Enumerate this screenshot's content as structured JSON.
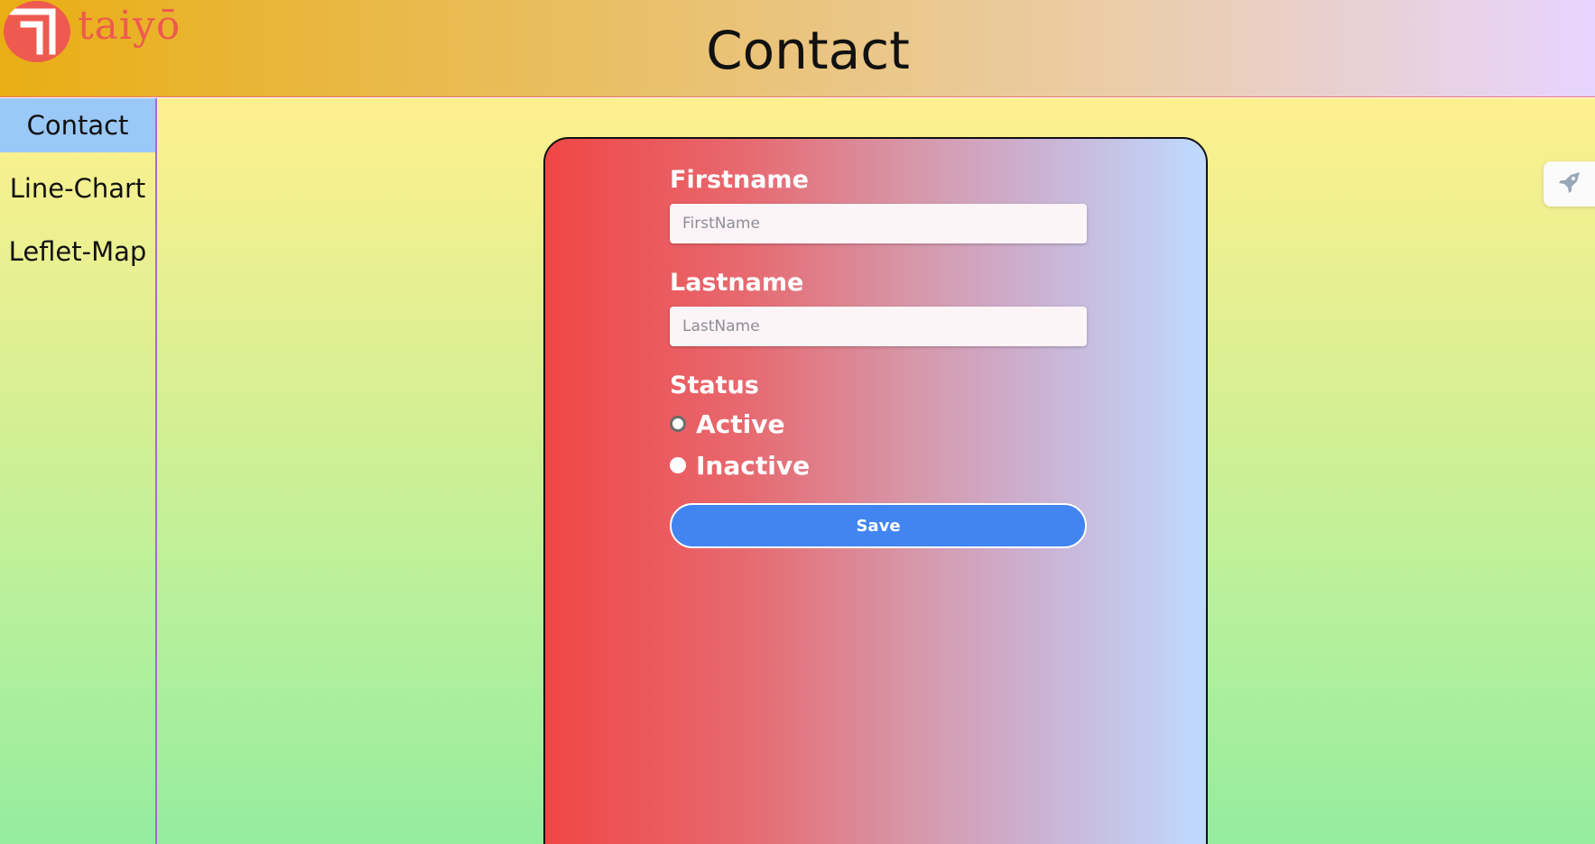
{
  "header": {
    "logo_text": "taiyō",
    "title": "Contact"
  },
  "sidebar": {
    "items": [
      {
        "label": "Contact",
        "active": true
      },
      {
        "label": "Line-Chart",
        "active": false
      },
      {
        "label": "Leflet-Map",
        "active": false
      }
    ]
  },
  "form": {
    "firstname": {
      "label": "Firstname",
      "placeholder": "FirstName",
      "value": ""
    },
    "lastname": {
      "label": "Lastname",
      "placeholder": "LastName",
      "value": ""
    },
    "status": {
      "label": "Status",
      "options": [
        {
          "label": "Active"
        },
        {
          "label": "Inactive"
        }
      ]
    },
    "save_label": "Save"
  },
  "float_tab": {
    "icon": "rocket-icon"
  },
  "colors": {
    "brand": "#ee5a4f",
    "sidebar_active": "#9ac9f8",
    "save_button": "#4285f0"
  }
}
